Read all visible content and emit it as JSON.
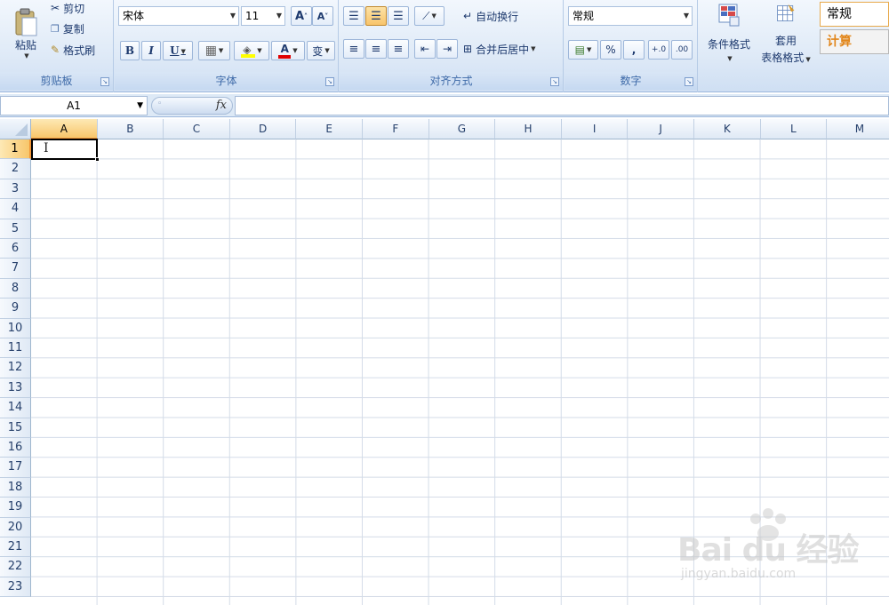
{
  "ribbon": {
    "clipboard": {
      "paste": "粘贴",
      "cut": "剪切",
      "copy": "复制",
      "format_painter": "格式刷",
      "label": "剪贴板"
    },
    "font": {
      "font_name": "宋体",
      "font_size": "11",
      "grow": "A",
      "shrink": "A",
      "bold": "B",
      "italic": "I",
      "underline": "U",
      "font_color_glyph": "A",
      "phonetic": "变",
      "label": "字体"
    },
    "alignment": {
      "wrap_text": "自动换行",
      "merge_center": "合并后居中",
      "label": "对齐方式"
    },
    "number": {
      "format": "常规",
      "percent": "%",
      "comma": ",",
      "label": "数字"
    },
    "styles": {
      "conditional": "条件格式",
      "table_format_1": "套用",
      "table_format_2": "表格格式",
      "style_normal": "常规",
      "style_calc": "计算"
    }
  },
  "formula_bar": {
    "name_box": "A1",
    "fx": "fx",
    "value": ""
  },
  "sheet": {
    "columns": [
      "A",
      "B",
      "C",
      "D",
      "E",
      "F",
      "G",
      "H",
      "I",
      "J",
      "K",
      "L",
      "M"
    ],
    "rows": [
      "1",
      "2",
      "3",
      "4",
      "5",
      "6",
      "7",
      "8",
      "9",
      "10",
      "11",
      "12",
      "13",
      "14",
      "15",
      "16",
      "17",
      "18",
      "19",
      "20",
      "21",
      "22",
      "23"
    ],
    "selected_col": "A",
    "selected_row": "1"
  },
  "watermark": {
    "logo": "Bai du 经验",
    "url": "jingyan.baidu.com"
  },
  "colors": {
    "selection_orange": "#f8c66b",
    "ribbon_blue": "#dfeaf7",
    "font_color_red": "#e00000",
    "highlight_yellow": "#ffff00"
  }
}
